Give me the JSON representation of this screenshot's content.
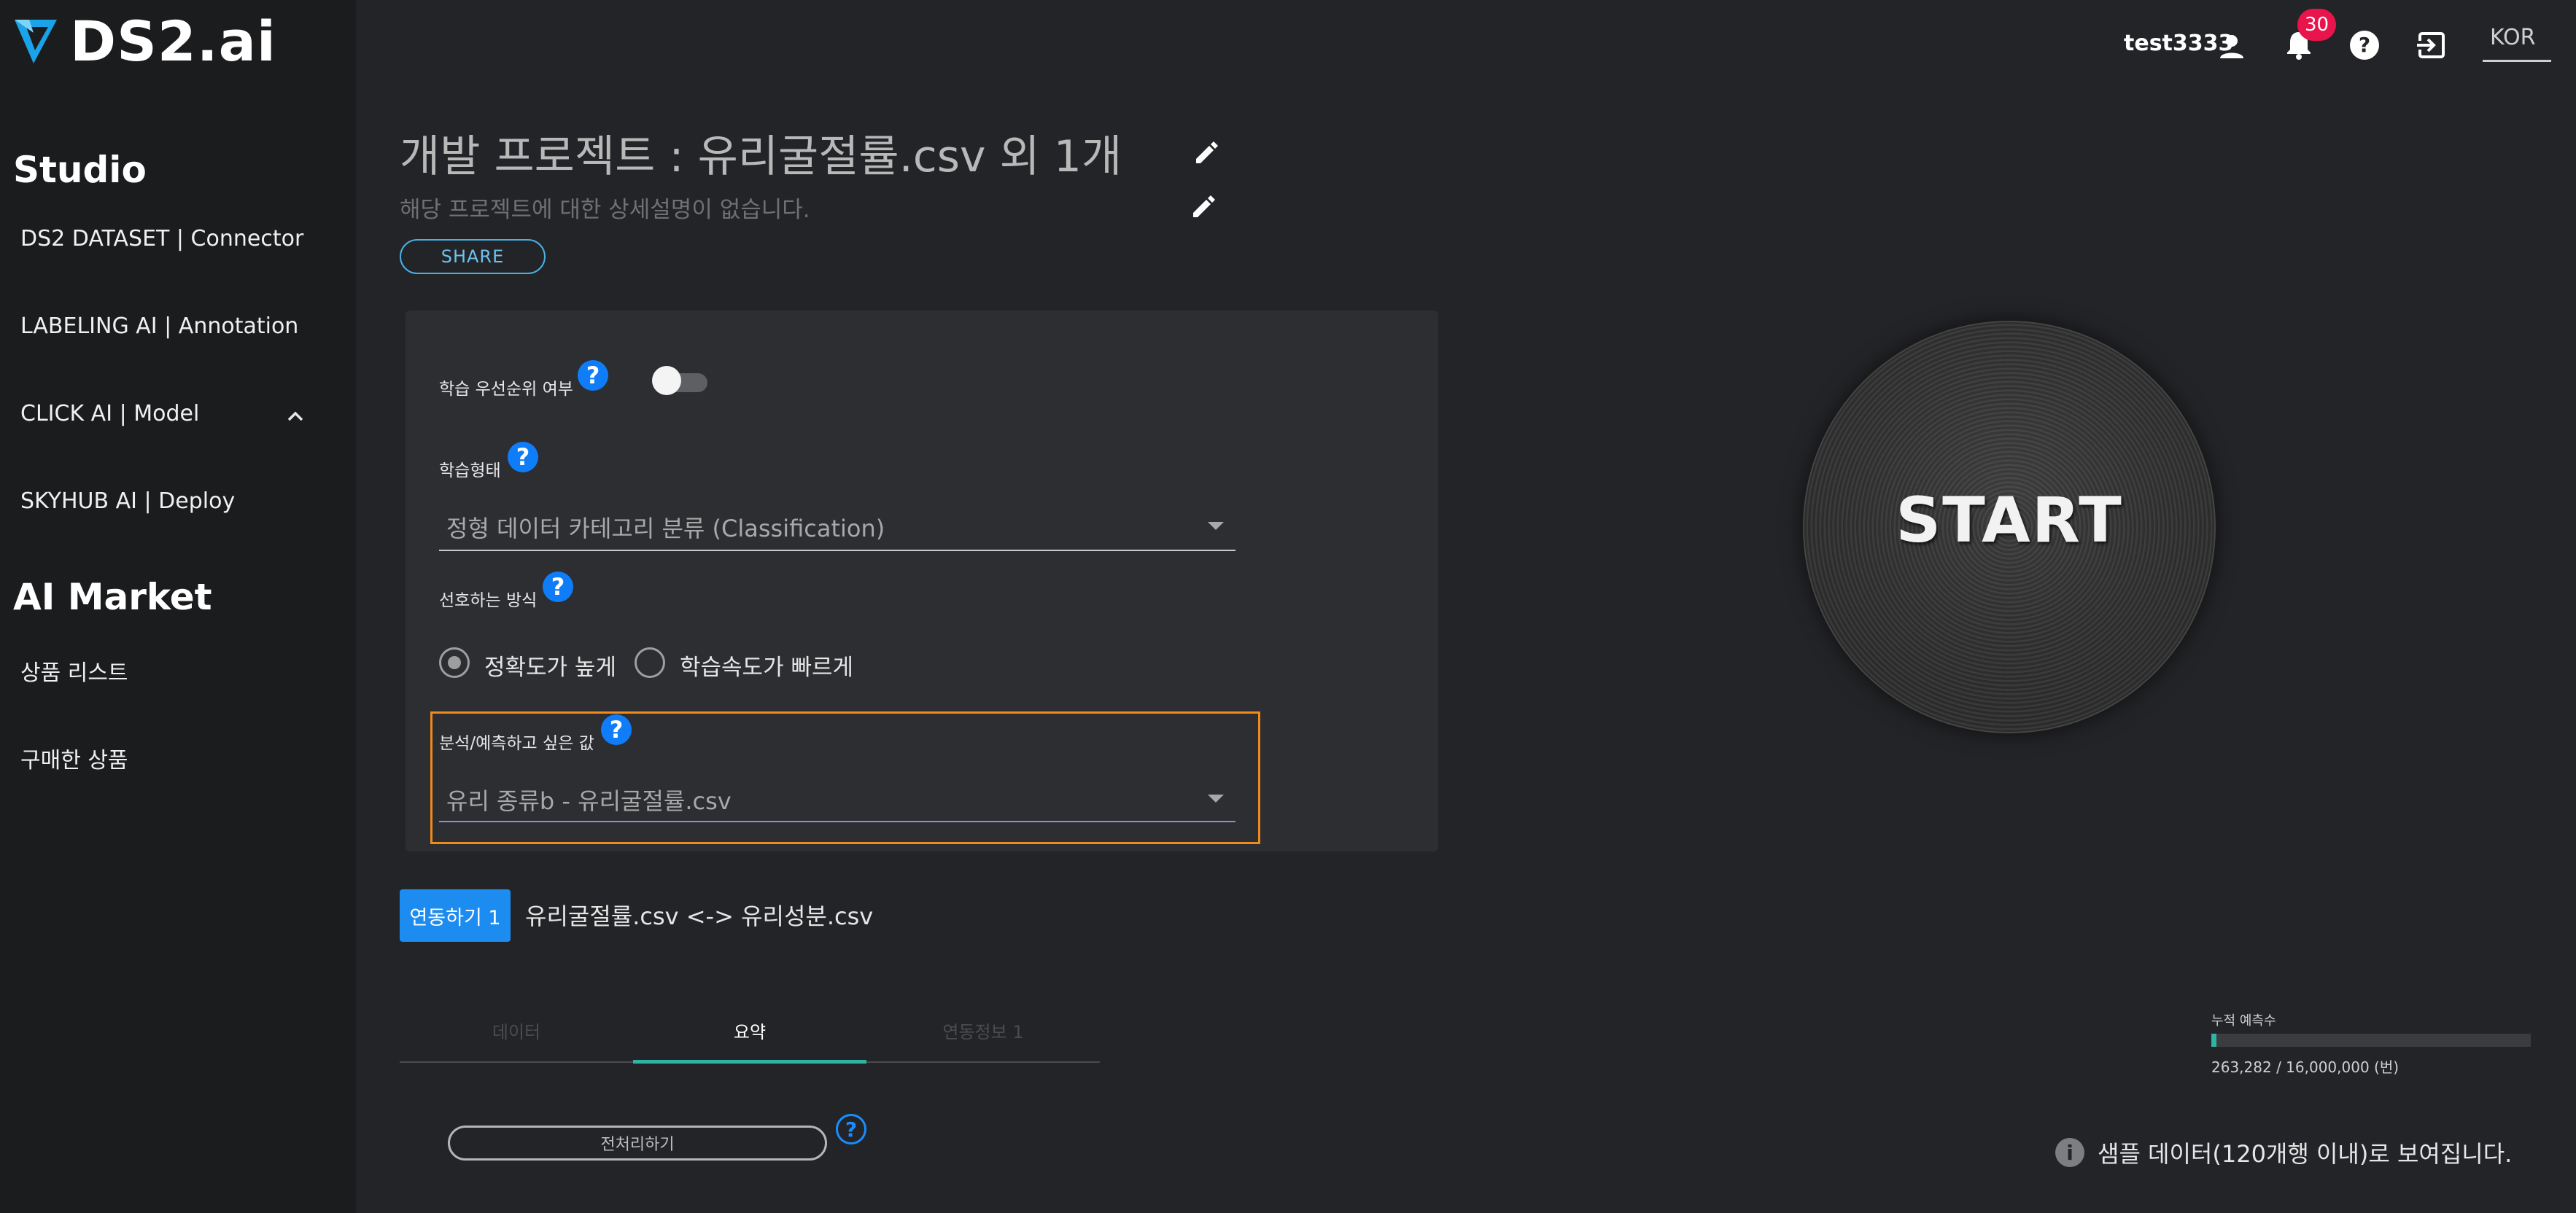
{
  "brand": {
    "name": "DS2.ai"
  },
  "sidebar": {
    "studio_heading": "Studio",
    "studio_items": [
      {
        "label": "DS2 DATASET | Connector"
      },
      {
        "label": "LABELING AI | Annotation"
      },
      {
        "label": "CLICK AI | Model"
      },
      {
        "label": "SKYHUB AI | Deploy"
      }
    ],
    "market_heading": "AI Market",
    "market_items": [
      {
        "label": "상품 리스트"
      },
      {
        "label": "구매한 상품"
      }
    ]
  },
  "topbar": {
    "username": "test3333",
    "notification_count": "30",
    "language": "KOR"
  },
  "project": {
    "title": "개발 프로젝트 : 유리굴절률.csv 외 1개",
    "description": "해당 프로젝트에 대한 상세설명이 없습니다.",
    "share_label": "SHARE"
  },
  "form": {
    "priority_label": "학습 우선순위 여부",
    "priority_toggle_on": false,
    "learning_type_label": "학습형태",
    "learning_type_value": "정형 데이터 카테고리 분류 (Classification)",
    "preferred_method_label": "선호하는 방식",
    "method_options": [
      {
        "label": "정확도가 높게",
        "selected": true
      },
      {
        "label": "학습속도가 빠르게",
        "selected": false
      }
    ],
    "target_label": "분석/예측하고 싶은 값",
    "target_value": "유리 종류b - 유리굴절률.csv"
  },
  "link": {
    "button_label": "연동하기 1",
    "description": "유리굴절률.csv <-> 유리성분.csv"
  },
  "tabs": [
    {
      "label": "데이터",
      "active": false
    },
    {
      "label": "요약",
      "active": true
    },
    {
      "label": "연동정보 1",
      "active": false
    }
  ],
  "preprocess": {
    "label": "전처리하기"
  },
  "start": {
    "label": "START"
  },
  "usage": {
    "label": "누적 예측수",
    "value_text": "263,282 / 16,000,000 (번)",
    "fraction": 0.0165
  },
  "notice": {
    "text": "샘플 데이터(120개행 이내)로 보여집니다."
  },
  "colors": {
    "accent_blue": "#1d8cf0",
    "help_blue": "#0f7df8",
    "teal": "#2fb3a3",
    "highlight_orange": "#f08a1c",
    "badge_red": "#e8144b"
  }
}
